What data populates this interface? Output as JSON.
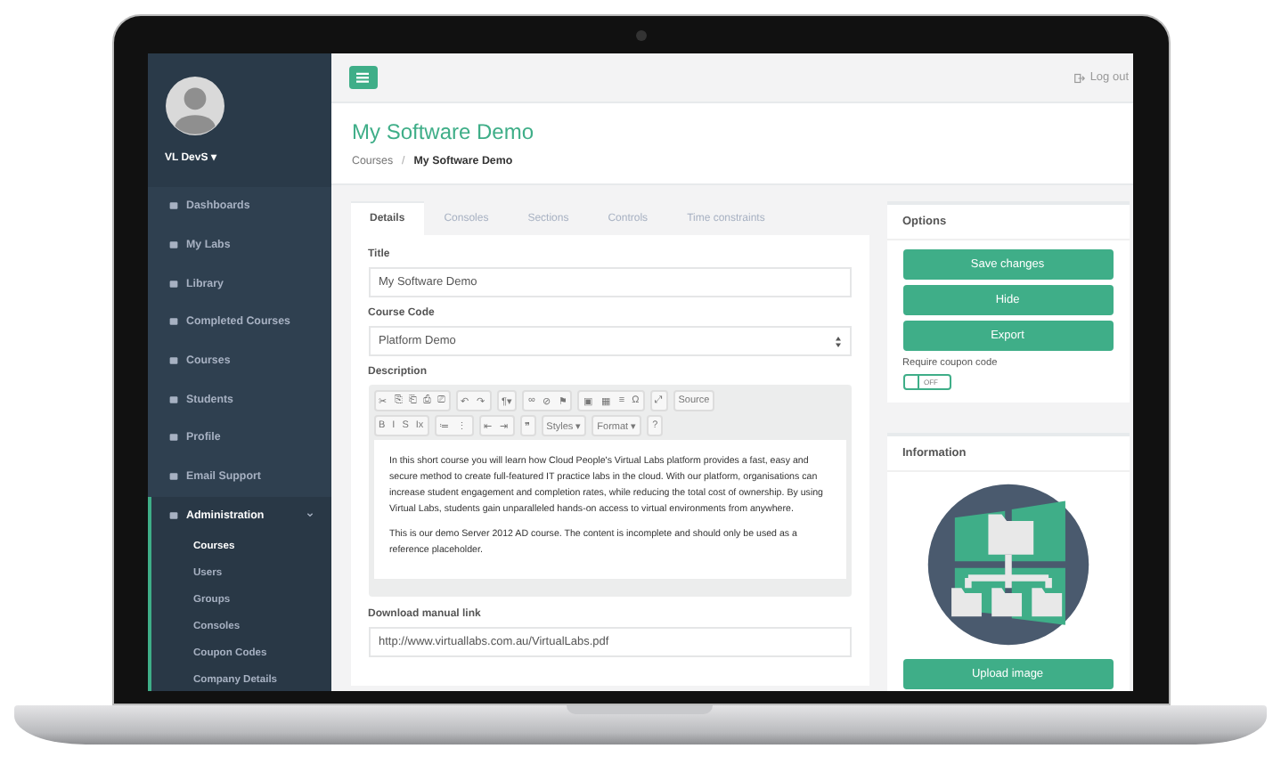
{
  "sidebar": {
    "user": {
      "name": "VL DevS",
      "caret": "▾"
    },
    "items": [
      {
        "label": "Dashboards",
        "selected": false
      },
      {
        "label": "My Labs",
        "selected": false
      },
      {
        "label": "Library",
        "selected": false
      },
      {
        "label": "Completed Courses",
        "selected": false
      },
      {
        "label": "Courses",
        "selected": false
      },
      {
        "label": "Students",
        "selected": false
      },
      {
        "label": "Profile",
        "selected": false
      },
      {
        "label": "Email Support",
        "selected": false
      },
      {
        "label": "Administration",
        "selected": true,
        "expanded": true,
        "children": [
          {
            "label": "Courses",
            "selected": true
          },
          {
            "label": "Users",
            "selected": false
          },
          {
            "label": "Groups",
            "selected": false
          },
          {
            "label": "Consoles",
            "selected": false
          },
          {
            "label": "Coupon Codes",
            "selected": false
          },
          {
            "label": "Company Details",
            "selected": false
          }
        ]
      }
    ]
  },
  "topbar": {
    "logout": "Log out"
  },
  "page": {
    "title": "My Software Demo",
    "separator": "/",
    "breadcrumb": [
      {
        "label": "Courses",
        "selected": false
      },
      {
        "label": "My Software Demo",
        "selected": true
      }
    ]
  },
  "tabs": [
    {
      "label": "Details",
      "selected": true
    },
    {
      "label": "Consoles",
      "selected": false
    },
    {
      "label": "Sections",
      "selected": false
    },
    {
      "label": "Controls",
      "selected": false
    },
    {
      "label": "Time constraints",
      "selected": false
    }
  ],
  "form": {
    "title": {
      "label": "Title",
      "value": "My Software Demo"
    },
    "course_code": {
      "label": "Course Code",
      "value": "Platform Demo"
    },
    "description": {
      "label": "Description",
      "toolbar": [
        [
          [
            "✂",
            "⎘",
            "⎗",
            "⎙",
            "⎚"
          ],
          [
            "↶",
            "↷"
          ],
          [
            "¶▾"
          ],
          [
            "∞",
            "⊘",
            "⚑"
          ],
          [
            "▣",
            "▦",
            "≡",
            "Ω"
          ],
          [
            "⤢"
          ],
          [
            "Source"
          ]
        ],
        [
          [
            "B",
            "I",
            "S",
            "Ix"
          ],
          [
            "≔",
            "⋮"
          ],
          [
            "⇤",
            "⇥"
          ],
          [
            "❞"
          ],
          [
            "Styles ▾"
          ],
          [
            "Format ▾"
          ],
          [
            "?"
          ]
        ]
      ],
      "paragraphs": [
        "In this short course you will learn how Cloud People's Virtual Labs platform provides a fast, easy and secure method to create full-featured IT practice labs in the cloud. With our platform, organisations can increase student engagement and completion rates, while reducing the total cost of ownership. By using Virtual Labs, students gain unparalleled hands-on access to virtual environments from anywhere.",
        "This is our demo Server 2012 AD course. The content is incomplete and should only be used as a reference placeholder."
      ]
    },
    "manual_link": {
      "label": "Download manual link",
      "value": "http://www.virtuallabs.com.au/VirtualLabs.pdf"
    }
  },
  "options": {
    "title": "Options",
    "buttons": [
      "Save changes",
      "Hide",
      "Export"
    ],
    "coupon": {
      "label": "Require coupon code",
      "on": false,
      "state_text": "OFF"
    }
  },
  "information": {
    "title": "Information",
    "button": "Upload image"
  }
}
